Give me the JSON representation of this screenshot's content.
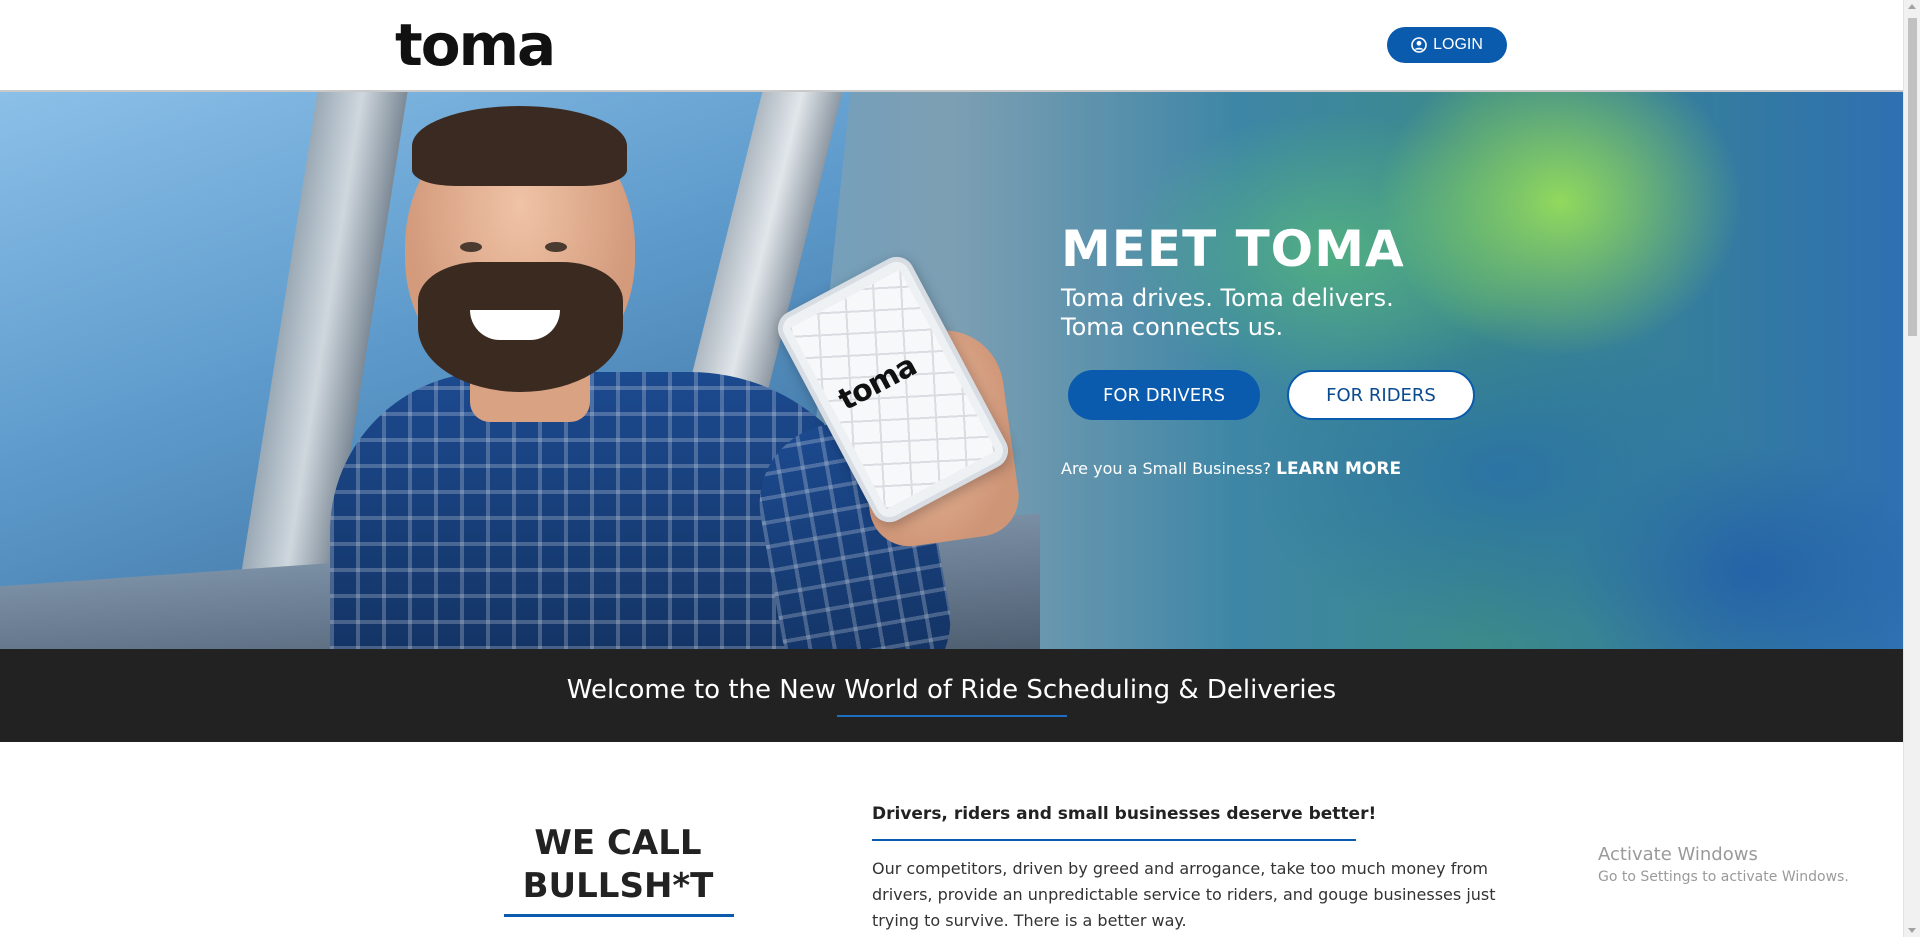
{
  "header": {
    "logo_text": "toma",
    "login_label": "LOGIN",
    "login_icon": "user-circle-icon"
  },
  "hero": {
    "title": "MEET TOMA",
    "subtitle_line1": "Toma drives. Toma delivers.",
    "subtitle_line2": "Toma connects us.",
    "drivers_button": "FOR DRIVERS",
    "riders_button": "FOR RIDERS",
    "small_business_prompt": "Are you a Small Business?",
    "learn_more_link": "LEARN MORE",
    "phone_logo_text": "toma"
  },
  "welcome_band": {
    "title": "Welcome to the New World of Ride Scheduling & Deliveries"
  },
  "content": {
    "callout_line1": "WE CALL",
    "callout_line2": "BULLSH*T",
    "headline": "Drivers, riders and small businesses deserve better!",
    "body": "Our competitors, driven by greed and arrogance, take too much money from drivers, provide an unpredictable service to riders, and gouge businesses just trying to survive. There is a better way."
  },
  "watermark": {
    "title": "Activate Windows",
    "subtitle": "Go to Settings to activate Windows."
  },
  "colors": {
    "brand_blue": "#0a5aad",
    "band_dark": "#222222",
    "text_dark": "#222222"
  }
}
